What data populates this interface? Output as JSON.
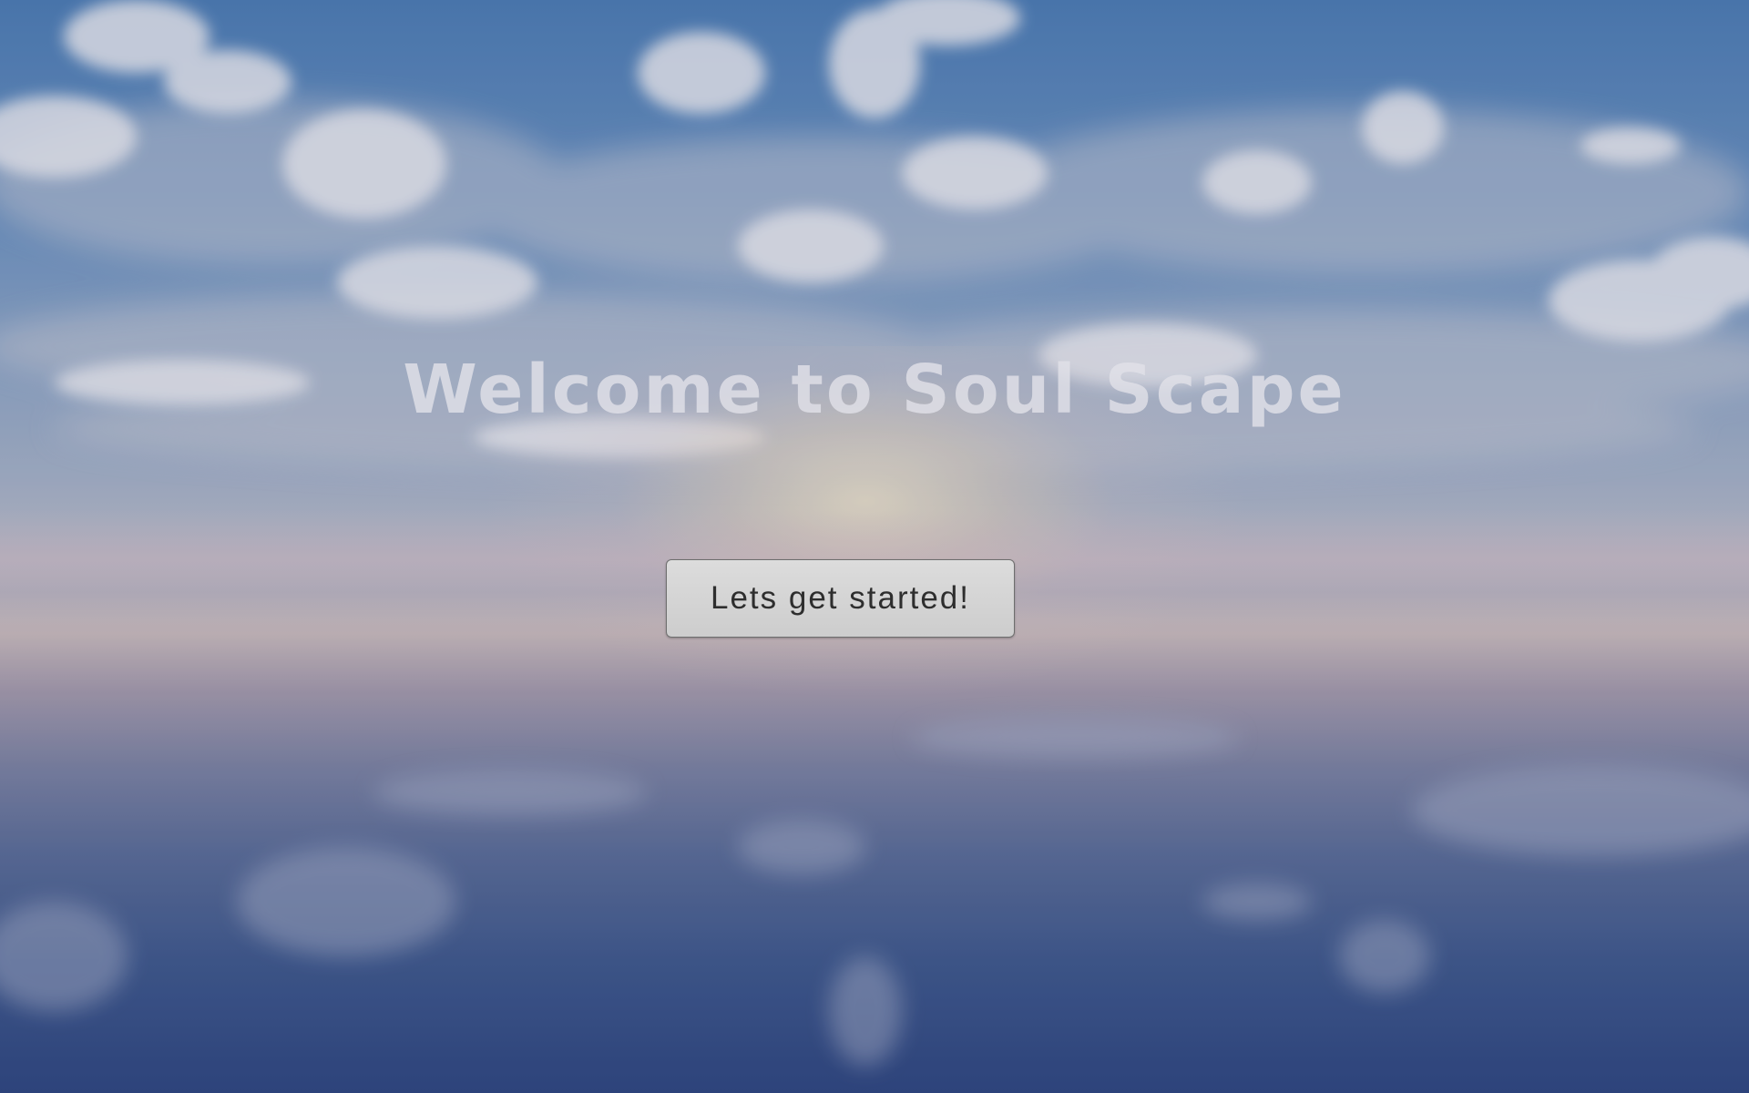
{
  "page": {
    "title": "Welcome to Soul Scape"
  },
  "start_button": {
    "label": "Lets get started!"
  },
  "colors": {
    "sky_top": "#4d7fb8",
    "horizon": "#cdbfc0",
    "sea_bottom": "#2e4782",
    "title_text": "#e1e1e8",
    "button_bg": "#d5d5d5",
    "button_text": "#2e2e2e"
  },
  "background": {
    "icon": "sky-and-ocean-reflection"
  }
}
